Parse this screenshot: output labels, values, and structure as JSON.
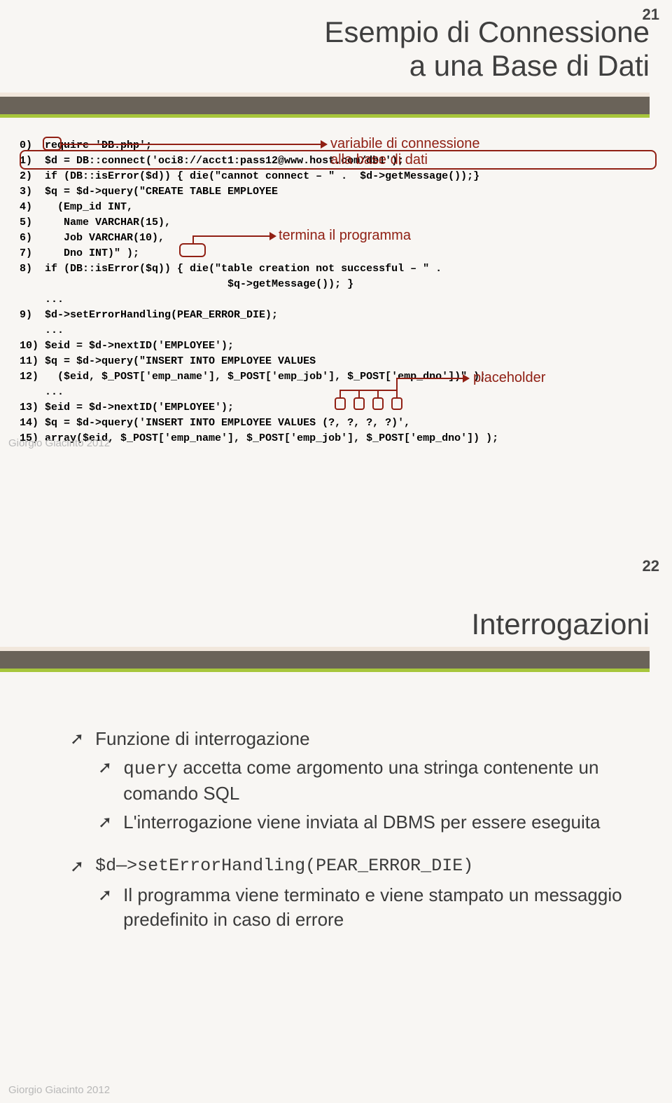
{
  "slide1": {
    "page": "21",
    "title_line1": "Esempio di Connessione",
    "title_line2": "a una Base di Dati",
    "code": {
      "l0": "0)  require 'DB.php';",
      "l1": "1)  $d = DB::connect('oci8://acct1:pass12@www.host.com/db1');",
      "l2": "2)  if (DB::isError($d)) { die(\"cannot connect – \" .  $d->getMessage());}",
      "l3": "3)  $q = $d->query(\"CREATE TABLE EMPLOYEE",
      "l4": "4)    (Emp_id INT,",
      "l5": "5)     Name VARCHAR(15),",
      "l6": "6)     Job VARCHAR(10),",
      "l7": "7)     Dno INT)\" );",
      "l8": "8)  if (DB::isError($q)) { die(\"table creation not successful – \" .",
      "l8b": "                                 $q->getMessage()); }",
      "l9dots": "    ...",
      "l9": "9)  $d->setErrorHandling(PEAR_ERROR_DIE);",
      "l10dots": "    ...",
      "l10": "10) $eid = $d->nextID('EMPLOYEE');",
      "l11": "11) $q = $d->query(\"INSERT INTO EMPLOYEE VALUES",
      "l12": "12)   ($eid, $_POST['emp_name'], $_POST['emp_job'], $_POST['emp_dno'])\" );",
      "l13dots": "    ...",
      "l13": "13) $eid = $d->nextID('EMPLOYEE');",
      "l14": "14) $q = $d->query('INSERT INTO EMPLOYEE VALUES (?, ?, ?, ?)',",
      "l15": "15) array($eid, $_POST['emp_name'], $_POST['emp_job'], $_POST['emp_dno']) );"
    },
    "ann": {
      "var_conn": "variabile di connessione\nalla base di dati",
      "termina": "termina il programma",
      "placeholder": "placeholder"
    },
    "footer": "Giorgio Giacinto 2012"
  },
  "slide2": {
    "page": "22",
    "title": "Interrogazioni",
    "bullets": {
      "b1": "Funzione di interrogazione",
      "b1_1_pre": "query",
      "b1_1_rest": " accetta come argomento una stringa contenente un comando SQL",
      "b1_2": "L'interrogazione viene inviata al DBMS per essere eseguita",
      "b2_code": "$d—>setErrorHandling(PEAR_ERROR_DIE)",
      "b2_1": "Il programma viene terminato e viene stampato un messaggio predefinito in caso di errore"
    },
    "footer": "Giorgio Giacinto 2012"
  }
}
